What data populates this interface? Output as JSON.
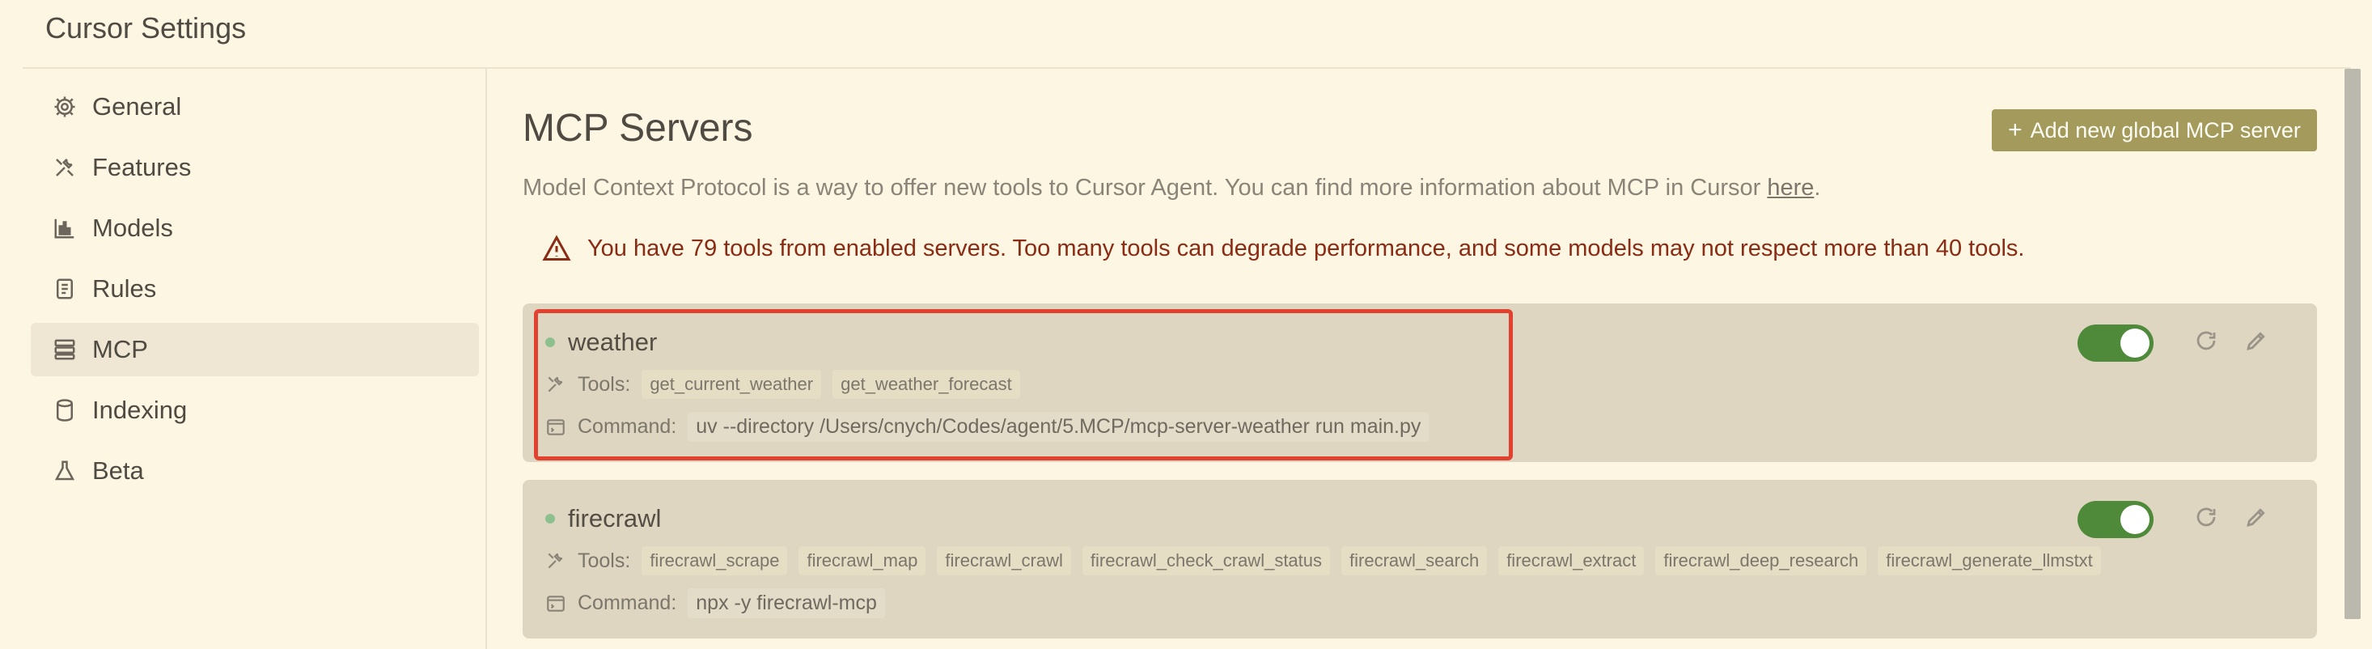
{
  "window": {
    "title": "Cursor Settings"
  },
  "sidebar": {
    "items": [
      {
        "label": "General",
        "icon": "gear-icon"
      },
      {
        "label": "Features",
        "icon": "tools-icon"
      },
      {
        "label": "Models",
        "icon": "bar-chart-icon"
      },
      {
        "label": "Rules",
        "icon": "document-icon"
      },
      {
        "label": "MCP",
        "icon": "server-icon",
        "active": true
      },
      {
        "label": "Indexing",
        "icon": "database-icon"
      },
      {
        "label": "Beta",
        "icon": "flask-icon"
      }
    ]
  },
  "main": {
    "title": "MCP Servers",
    "add_button_label": "Add new global MCP server",
    "subtitle_text": "Model Context Protocol is a way to offer new tools to Cursor Agent. You can find more information about MCP in Cursor ",
    "subtitle_link": "here",
    "subtitle_end": ".",
    "warning": "You have 79 tools from enabled servers. Too many tools can degrade performance, and some models may not respect more than 40 tools.",
    "tools_label": "Tools:",
    "command_label": "Command:"
  },
  "servers": [
    {
      "name": "weather",
      "enabled": true,
      "tools": [
        "get_current_weather",
        "get_weather_forecast"
      ],
      "command": "uv --directory /Users/cnych/Codes/agent/5.MCP/mcp-server-weather run main.py"
    },
    {
      "name": "firecrawl",
      "enabled": true,
      "tools": [
        "firecrawl_scrape",
        "firecrawl_map",
        "firecrawl_crawl",
        "firecrawl_check_crawl_status",
        "firecrawl_search",
        "firecrawl_extract",
        "firecrawl_deep_research",
        "firecrawl_generate_llmstxt"
      ],
      "command": "npx -y firecrawl-mcp"
    }
  ],
  "colors": {
    "background": "#fdf6e3",
    "accent_button": "#a39a5c",
    "toggle_on": "#4e8a3a",
    "warning": "#8a2b14",
    "highlight": "#e2412f"
  }
}
